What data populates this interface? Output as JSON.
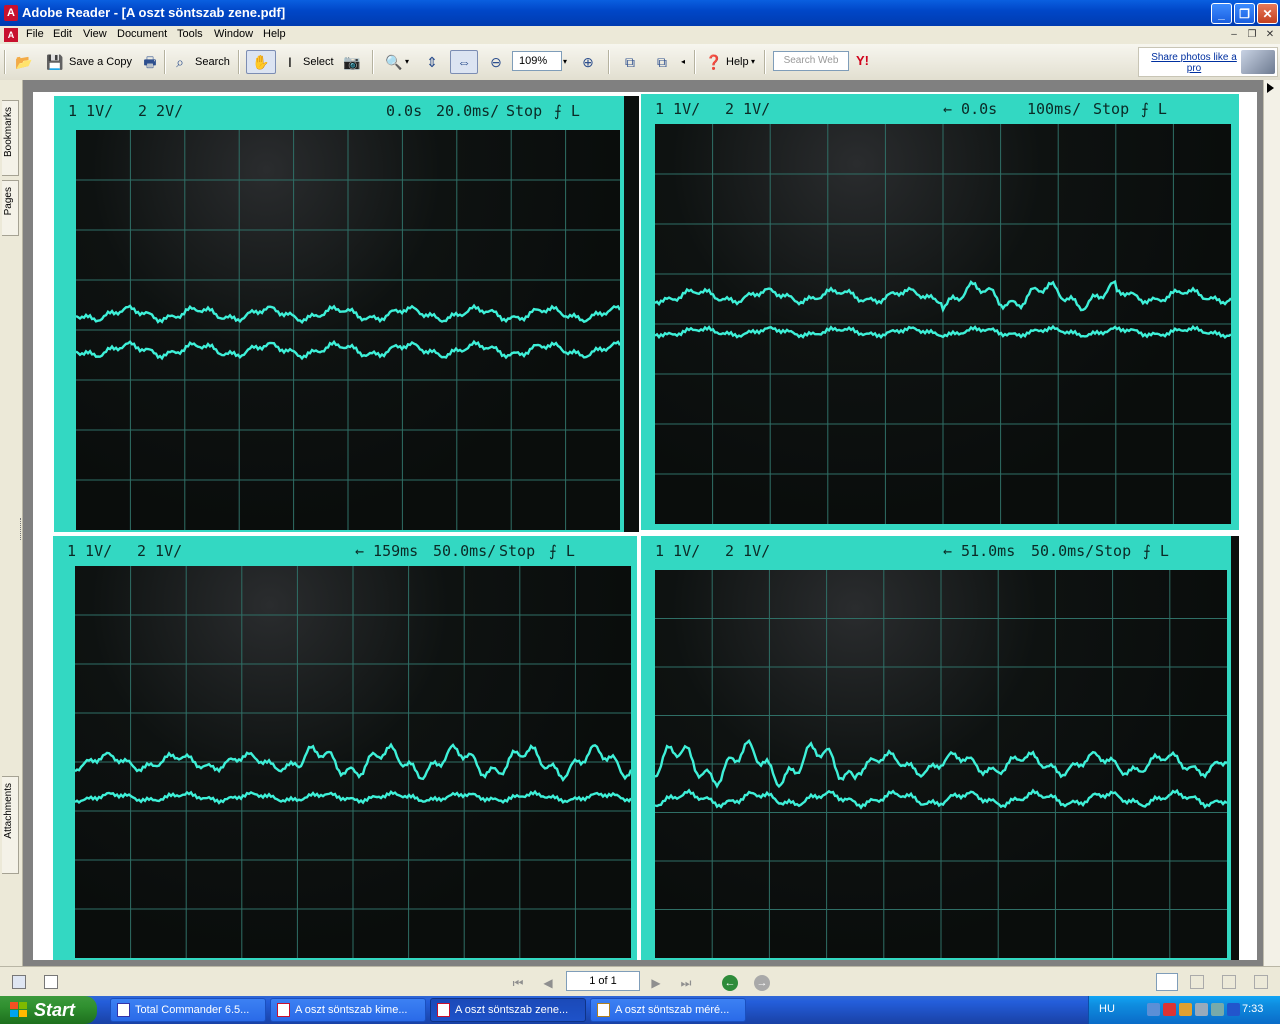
{
  "window": {
    "title": "Adobe Reader - [A oszt söntszab zene.pdf]",
    "buttons": {
      "minimize": "_",
      "maximize": "❐",
      "close": "✕"
    }
  },
  "menu": {
    "items": [
      "File",
      "Edit",
      "View",
      "Document",
      "Tools",
      "Window",
      "Help"
    ]
  },
  "toolbar": {
    "save_copy": "Save a Copy",
    "search": "Search",
    "select": "Select",
    "zoom_value": "109%",
    "help": "Help",
    "search_web_placeholder": "Search Web",
    "ad_text": "Share photos like a pro"
  },
  "nav_tabs": {
    "bookmarks": "Bookmarks",
    "pages": "Pages",
    "attachments": "Attachments"
  },
  "scopes": [
    {
      "ch1": "1  1V/",
      "ch2": "2  2V/",
      "pos": "0.0s",
      "time": "20.0ms/",
      "state": "Stop",
      "trig": "⨍ L"
    },
    {
      "ch1": "1  1V/",
      "ch2": "2  1V/",
      "pos": "← 0.0s",
      "time": "100ms/",
      "state": "Stop",
      "trig": "⨍ L"
    },
    {
      "ch1": "1  1V/",
      "ch2": "2  1V/",
      "pos": "← 159ms",
      "time": "50.0ms/",
      "state": "Stop",
      "trig": "⨍ L"
    },
    {
      "ch1": "1  1V/",
      "ch2": "2  1V/",
      "pos": "← 51.0ms",
      "time": "50.0ms/",
      "state": "Stop",
      "trig": "⨍ L"
    }
  ],
  "statusbar": {
    "page_field": "1 of 1"
  },
  "taskbar": {
    "start": "Start",
    "tasks": [
      "Total Commander 6.5...",
      "A oszt söntszab kime...",
      "A oszt söntszab zene...",
      "A oszt söntszab méré..."
    ],
    "lang": "HU",
    "clock": "7:33"
  },
  "colors": {
    "trace": "#3ef0d8",
    "bezel": "#33d8c2",
    "titlebar": "#0047c8"
  }
}
